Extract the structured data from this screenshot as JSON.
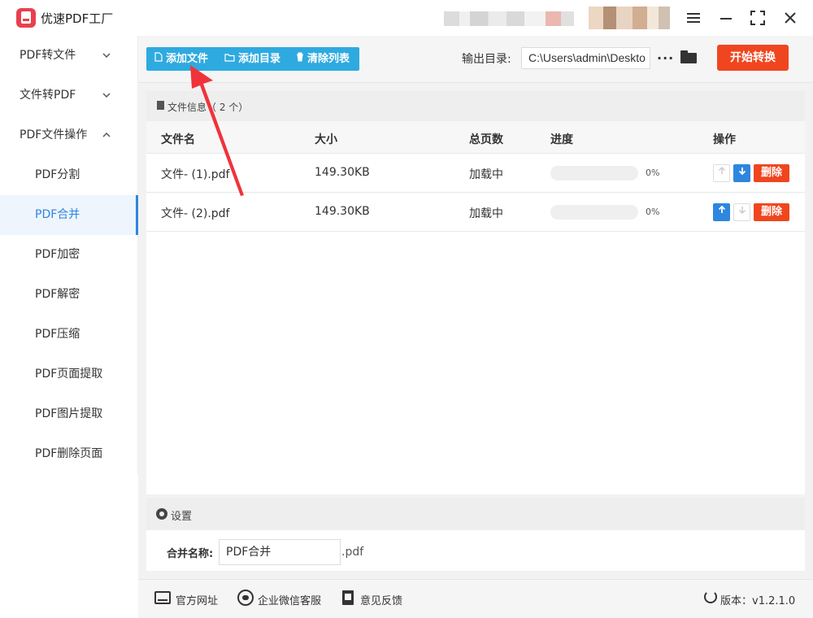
{
  "app": {
    "title": "优速PDF工厂"
  },
  "sidebar": {
    "groups": [
      {
        "label": "PDF转文件",
        "chevron": "⌄"
      },
      {
        "label": "文件转PDF",
        "chevron": "⌄"
      },
      {
        "label": "PDF文件操作",
        "chevron": "⌃"
      }
    ],
    "subitems": [
      {
        "label": "PDF分割"
      },
      {
        "label": "PDF合并",
        "active": true
      },
      {
        "label": "PDF加密"
      },
      {
        "label": "PDF解密"
      },
      {
        "label": "PDF压缩"
      },
      {
        "label": "PDF页面提取"
      },
      {
        "label": "PDF图片提取"
      },
      {
        "label": "PDF删除页面"
      }
    ]
  },
  "toolbar": {
    "add_file": "添加文件",
    "add_dir": "添加目录",
    "clear_list": "清除列表",
    "output_label": "输出目录:",
    "output_path": "C:\\Users\\admin\\Deskto",
    "more": "···",
    "start": "开始转换"
  },
  "file_panel": {
    "header": "文件信息（ 2 个）",
    "columns": [
      "文件名",
      "大小",
      "总页数",
      "进度",
      "操作"
    ],
    "rows": [
      {
        "name": "文件- (1).pdf",
        "size": "149.30KB",
        "pages": "加载中",
        "progress": 0,
        "progress_label": "0%",
        "up_enabled": false,
        "down_enabled": true,
        "delete": "删除"
      },
      {
        "name": "文件- (2).pdf",
        "size": "149.30KB",
        "pages": "加载中",
        "progress": 0,
        "progress_label": "0%",
        "up_enabled": true,
        "down_enabled": false,
        "delete": "删除"
      }
    ]
  },
  "settings": {
    "header": "设置",
    "merge_name_label": "合并名称:",
    "merge_name_value": "PDF合并",
    "ext": ".pdf"
  },
  "footer": {
    "website": "官方网址",
    "wechat": "企业微信客服",
    "feedback": "意见反馈",
    "version": "版本：v1.2.1.0"
  },
  "colors": {
    "accent": "#2e86de",
    "toolbar_blue": "#2eaae0",
    "danger": "#f0461f",
    "annotation": "#f0333a"
  }
}
